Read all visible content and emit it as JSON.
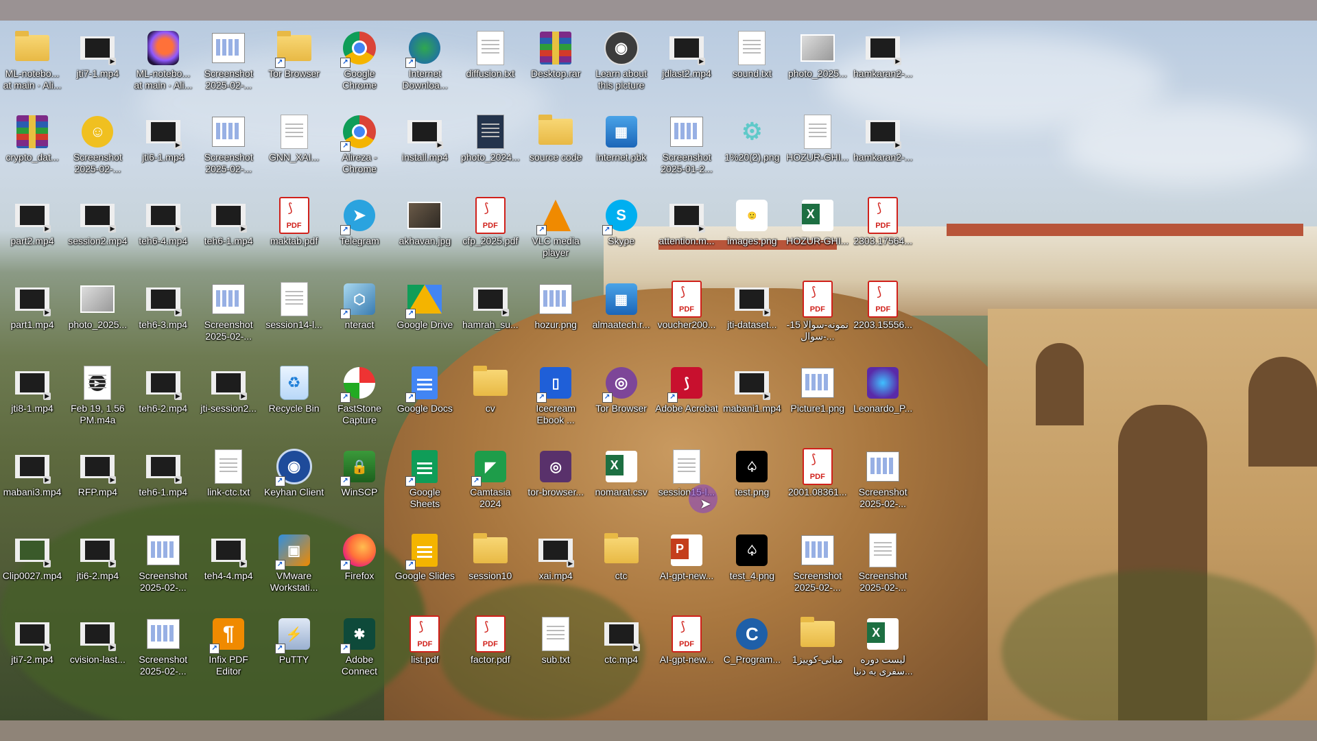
{
  "desktop": {
    "icons": [
      {
        "label": "ML-notebo... at main · Ali...",
        "type": "folder"
      },
      {
        "label": "jti7-1.mp4",
        "type": "video"
      },
      {
        "label": "ML-notebo... at main · Ali...",
        "type": "firefox-dark"
      },
      {
        "label": "Screenshot 2025-02-...",
        "type": "screenshot"
      },
      {
        "label": "Tor Browser",
        "type": "folder-tor"
      },
      {
        "label": "Google Chrome",
        "type": "chrome"
      },
      {
        "label": "Internet Downloa...",
        "type": "idm"
      },
      {
        "label": "diffusion.txt",
        "type": "doc"
      },
      {
        "label": "Desktop.rar",
        "type": "winrar"
      },
      {
        "label": "Learn about this picture",
        "type": "camera"
      },
      {
        "label": "jdlast2.mp4",
        "type": "video"
      },
      {
        "label": "sound.txt",
        "type": "doc"
      },
      {
        "label": "photo_2025...",
        "type": "image"
      },
      {
        "label": "hamkaran2-...",
        "type": "video"
      },
      {
        "label": "crypto_dat...",
        "type": "winrar"
      },
      {
        "label": "Screenshot 2025-02-...",
        "type": "cartoon"
      },
      {
        "label": "jti6-1.mp4",
        "type": "video"
      },
      {
        "label": "Screenshot 2025-02-...",
        "type": "screenshot-light"
      },
      {
        "label": "GNN_XAI...",
        "type": "gnn"
      },
      {
        "label": "Alireza - Chrome",
        "type": "chrome-user"
      },
      {
        "label": "install.mp4",
        "type": "video"
      },
      {
        "label": "photo_2024...",
        "type": "image-phone"
      },
      {
        "label": "source code",
        "type": "folder"
      },
      {
        "label": "internet.pbk",
        "type": "network"
      },
      {
        "label": "Screenshot 2025-01-2...",
        "type": "screenshot"
      },
      {
        "label": "1%20(2).png",
        "type": "gear"
      },
      {
        "label": "HOZUR-GHI...",
        "type": "doc"
      },
      {
        "label": "hamkaran2-...",
        "type": "video"
      },
      {
        "label": "part2.mp4",
        "type": "video"
      },
      {
        "label": "session2.mp4",
        "type": "video"
      },
      {
        "label": "teh6-4.mp4",
        "type": "video"
      },
      {
        "label": "teh6-1.mp4",
        "type": "video"
      },
      {
        "label": "maktab.pdf",
        "type": "pdf"
      },
      {
        "label": "Telegram",
        "type": "telegram"
      },
      {
        "label": "akhavan.jpg",
        "type": "photo"
      },
      {
        "label": "cfp_2025.pdf",
        "type": "pdf"
      },
      {
        "label": "VLC media player",
        "type": "vlc"
      },
      {
        "label": "Skype",
        "type": "skype"
      },
      {
        "label": "attention.m...",
        "type": "video"
      },
      {
        "label": "images.png",
        "type": "hugging"
      },
      {
        "label": "HOZUR-GHI...",
        "type": "excel"
      },
      {
        "label": "2303.17564...",
        "type": "pdf"
      },
      {
        "label": "part1.mp4",
        "type": "video"
      },
      {
        "label": "photo_2025...",
        "type": "image"
      },
      {
        "label": "teh6-3.mp4",
        "type": "video"
      },
      {
        "label": "Screenshot 2025-02-...",
        "type": "screenshot-red"
      },
      {
        "label": "session14-l...",
        "type": "doc"
      },
      {
        "label": "nteract",
        "type": "nteract"
      },
      {
        "label": "Google Drive",
        "type": "gdrive"
      },
      {
        "label": "hamrah_su...",
        "type": "video"
      },
      {
        "label": "hozur.png",
        "type": "screenshot"
      },
      {
        "label": "almaatech.r...",
        "type": "network-x"
      },
      {
        "label": "voucher200...",
        "type": "pdf"
      },
      {
        "label": "jti-dataset...",
        "type": "video"
      },
      {
        "label": "نمونه-سوالا 15-سوال-...",
        "type": "pdf"
      },
      {
        "label": "2203.15556...",
        "type": "pdf"
      },
      {
        "label": "jti8-1.mp4",
        "type": "video"
      },
      {
        "label": "Feb 19, 1.56 PM.m4a",
        "type": "audio"
      },
      {
        "label": "teh6-2.mp4",
        "type": "video"
      },
      {
        "label": "jti-session2...",
        "type": "video"
      },
      {
        "label": "Recycle Bin",
        "type": "recycle"
      },
      {
        "label": "FastStone Capture",
        "type": "faststone"
      },
      {
        "label": "Google Docs",
        "type": "gdocs"
      },
      {
        "label": "cv",
        "type": "folder"
      },
      {
        "label": "Icecream Ebook ...",
        "type": "icecream"
      },
      {
        "label": "Tor Browser",
        "type": "tor"
      },
      {
        "label": "Adobe Acrobat",
        "type": "acrobat"
      },
      {
        "label": "mabani1.mp4",
        "type": "video"
      },
      {
        "label": "Picture1.png",
        "type": "screenshot"
      },
      {
        "label": "Leonardo_P...",
        "type": "leonardo"
      },
      {
        "label": "mabani3.mp4",
        "type": "video"
      },
      {
        "label": "RFP.mp4",
        "type": "video"
      },
      {
        "label": "teh6-1.mp4",
        "type": "video"
      },
      {
        "label": "link-ctc.txt",
        "type": "doc"
      },
      {
        "label": "Keyhan Client",
        "type": "keyhan"
      },
      {
        "label": "WinSCP",
        "type": "winscp"
      },
      {
        "label": "Google Sheets",
        "type": "gsheets"
      },
      {
        "label": "Camtasia 2024",
        "type": "camtasia"
      },
      {
        "label": "tor-browser...",
        "type": "tor-box"
      },
      {
        "label": "nomarat.csv",
        "type": "excel"
      },
      {
        "label": "session15-l...",
        "type": "doc"
      },
      {
        "label": "test.png",
        "type": "test-png"
      },
      {
        "label": "2001.08361...",
        "type": "pdf"
      },
      {
        "label": "Screenshot 2025-02-...",
        "type": "screenshot"
      },
      {
        "label": "Clip0027.mp4",
        "type": "video-green"
      },
      {
        "label": "jti6-2.mp4",
        "type": "video"
      },
      {
        "label": "Screenshot 2025-02-...",
        "type": "screenshot-chart"
      },
      {
        "label": "teh4-4.mp4",
        "type": "video"
      },
      {
        "label": "VMware Workstati...",
        "type": "vmware"
      },
      {
        "label": "Firefox",
        "type": "firefox"
      },
      {
        "label": "Google Slides",
        "type": "gslides"
      },
      {
        "label": "session10",
        "type": "folder"
      },
      {
        "label": "xai.mp4",
        "type": "video"
      },
      {
        "label": "ctc",
        "type": "folder"
      },
      {
        "label": "AI-gpt-new...",
        "type": "ppt"
      },
      {
        "label": "test_4.png",
        "type": "test-png"
      },
      {
        "label": "Screenshot 2025-02-...",
        "type": "screenshot"
      },
      {
        "label": "Screenshot 2025-02-...",
        "type": "doc"
      },
      {
        "label": "jti7-2.mp4",
        "type": "video"
      },
      {
        "label": "cvision-last...",
        "type": "video"
      },
      {
        "label": "Screenshot 2025-02-...",
        "type": "screenshot-list"
      },
      {
        "label": "Infix PDF Editor",
        "type": "infix"
      },
      {
        "label": "PuTTY",
        "type": "putty"
      },
      {
        "label": "Adobe Connect",
        "type": "adobe-connect"
      },
      {
        "label": "list.pdf",
        "type": "pdf"
      },
      {
        "label": "factor.pdf",
        "type": "pdf"
      },
      {
        "label": "sub.txt",
        "type": "doc"
      },
      {
        "label": "ctc.mp4",
        "type": "video"
      },
      {
        "label": "AI-gpt-new...",
        "type": "pdf"
      },
      {
        "label": "C_Program...",
        "type": "c-program"
      },
      {
        "label": "مبانی-کوییز1",
        "type": "folder"
      },
      {
        "label": "لیست دوره سفری به دنیا...",
        "type": "excel"
      }
    ],
    "pdf_badge": "PDF",
    "shortcut_glyph": "↗"
  },
  "colors": {
    "label_text": "#ffffff",
    "top_band": "#9a9293",
    "bottom_band": "#8f8478",
    "cursor_halo": "#8a3ccf"
  }
}
